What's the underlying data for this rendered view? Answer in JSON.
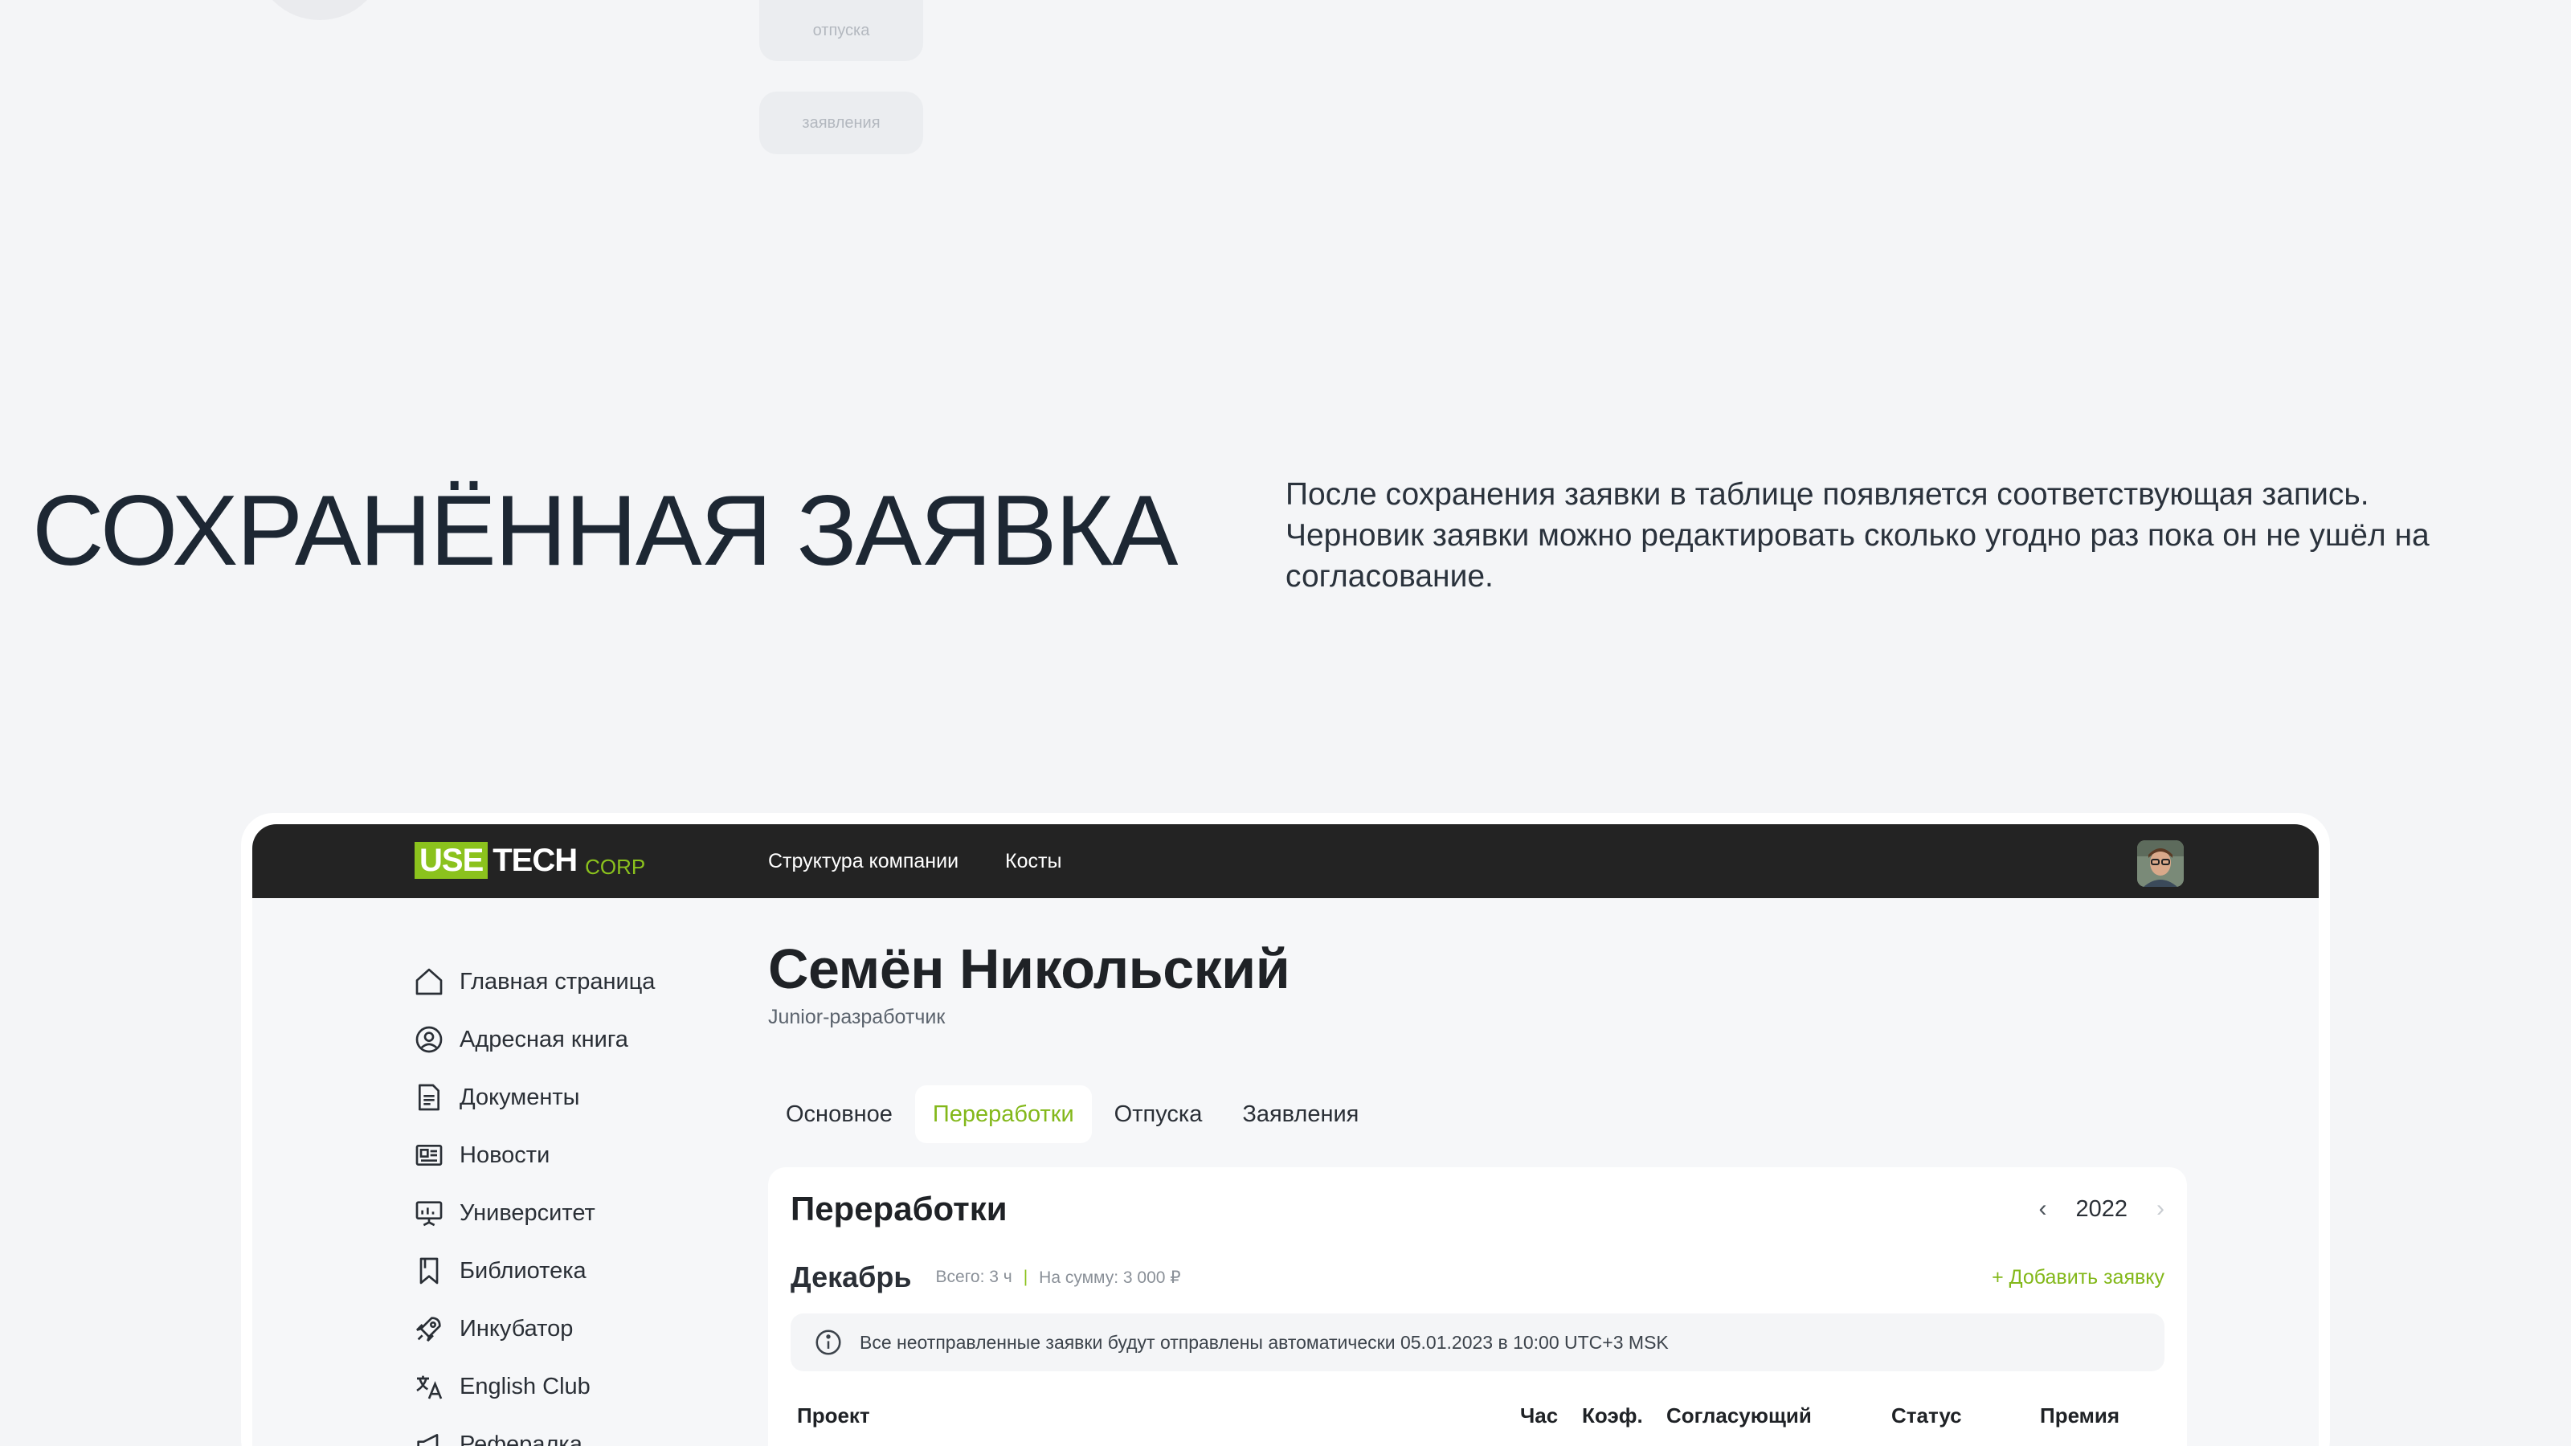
{
  "ghost": {
    "pill_1": "отпуска",
    "pill_2": "заявления"
  },
  "hero": {
    "title": "СОХРАНЁННАЯ ЗАЯВКА",
    "description": "После сохранения заявки в таблице появляется соответствующая запись. Черновик заявки можно редактировать сколько угодно раз пока он не ушёл на согласование."
  },
  "topbar": {
    "logo_use": "USE",
    "logo_tech": "TECH",
    "logo_corp": "CORP",
    "nav": [
      "Структура компании",
      "Косты"
    ]
  },
  "sidebar": {
    "items": [
      {
        "label": "Главная страница",
        "icon": "home-icon"
      },
      {
        "label": "Адресная книга",
        "icon": "contact-icon"
      },
      {
        "label": "Документы",
        "icon": "document-icon"
      },
      {
        "label": "Новости",
        "icon": "news-icon"
      },
      {
        "label": "Университет",
        "icon": "presentation-icon"
      },
      {
        "label": "Библиотека",
        "icon": "bookmark-icon"
      },
      {
        "label": "Инкубатор",
        "icon": "rocket-icon"
      },
      {
        "label": "English Club",
        "icon": "translate-icon"
      },
      {
        "label": "Рефералка",
        "icon": "megaphone-icon"
      }
    ]
  },
  "profile": {
    "name": "Семён Никольский",
    "role": "Junior-разработчик"
  },
  "tabs": [
    {
      "label": "Основное",
      "active": false
    },
    {
      "label": "Переработки",
      "active": true
    },
    {
      "label": "Отпуска",
      "active": false
    },
    {
      "label": "Заявления",
      "active": false
    }
  ],
  "panel": {
    "title": "Переработки",
    "year": "2022",
    "month": "Декабрь",
    "total_hours": "Всего: 3 ч",
    "total_sum": "На сумму: 3 000 ₽",
    "add_label": "+ Добавить заявку",
    "notice": "Все неотправленные заявки будут отправлены автоматически 05.01.2023 в 10:00 UTC+3 MSK",
    "columns": [
      "Проект",
      "Час",
      "Коэф.",
      "Согласующий",
      "Статус",
      "Премия"
    ]
  },
  "colors": {
    "accent": "#8bc21d",
    "topbar": "#232323",
    "background": "#f4f5f7"
  }
}
